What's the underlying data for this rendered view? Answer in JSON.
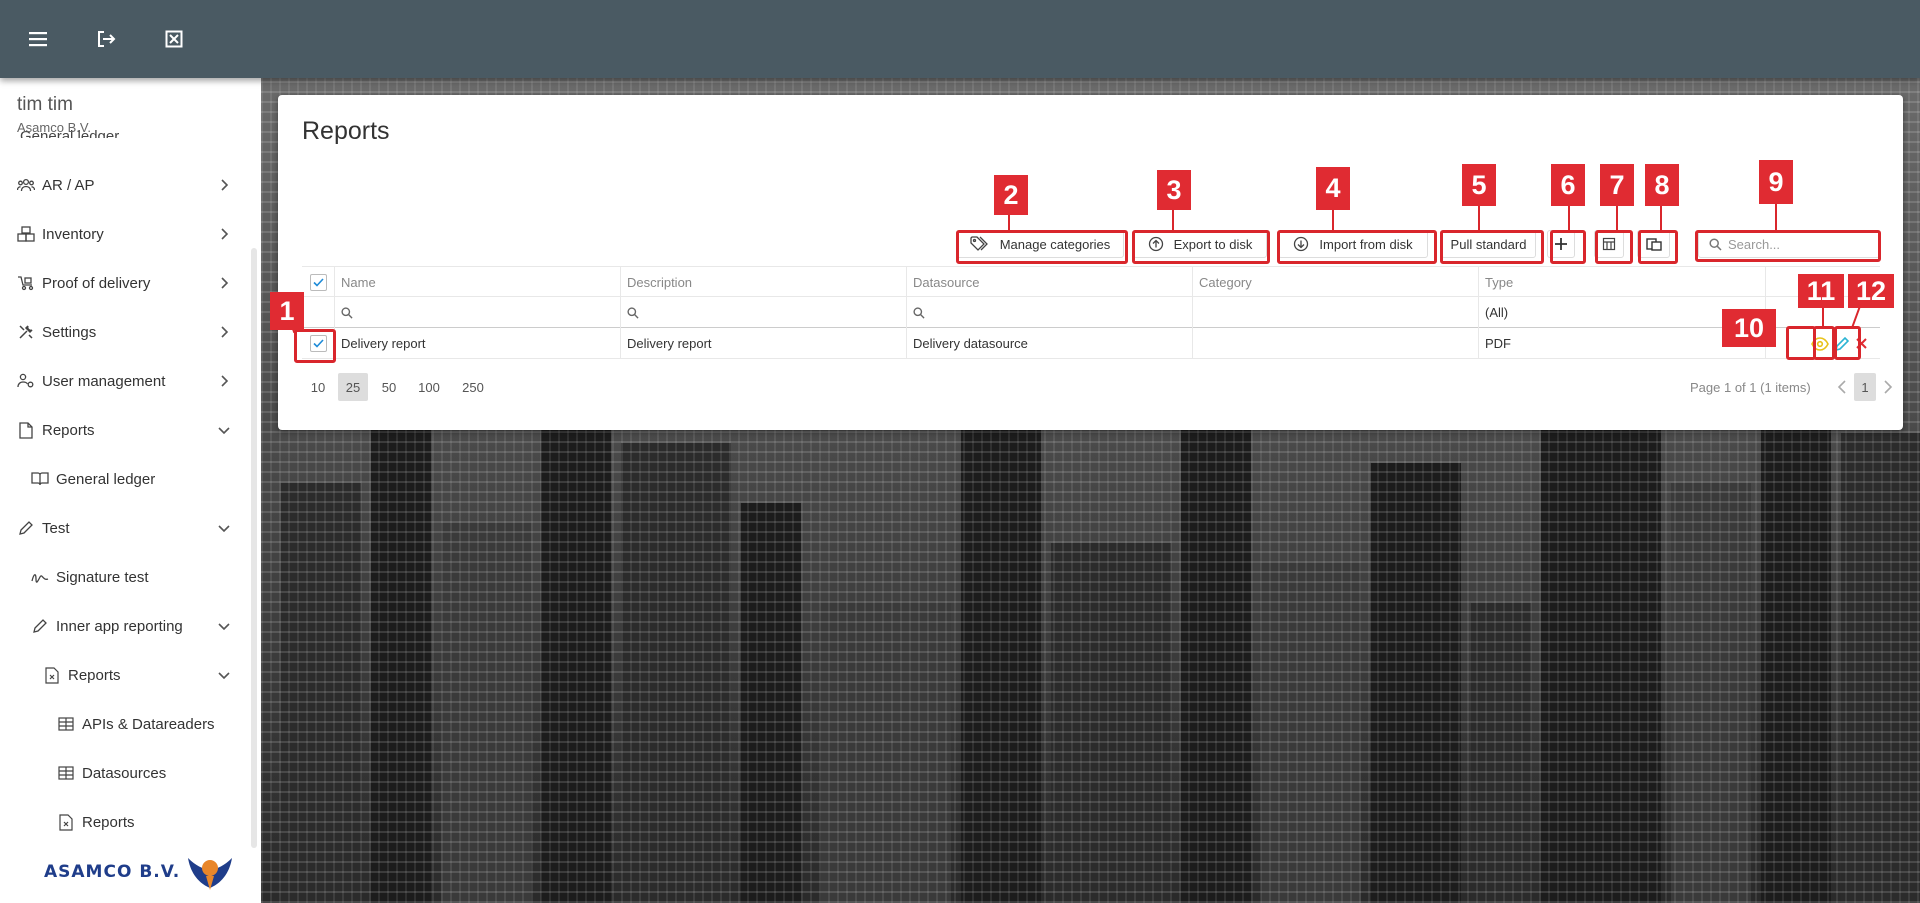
{
  "topbar": {
    "icons": [
      "menu-icon",
      "logout-icon",
      "close-window-icon"
    ]
  },
  "sidebar": {
    "user_name": "tim tim",
    "company": "Asamco B.V.",
    "cut_item": "General ledger",
    "items": [
      {
        "label": "AR / AP",
        "icon": "users-icon",
        "chevron": "right"
      },
      {
        "label": "Inventory",
        "icon": "boxes-icon",
        "chevron": "right"
      },
      {
        "label": "Proof of delivery",
        "icon": "delivery-icon",
        "chevron": "right"
      },
      {
        "label": "Settings",
        "icon": "tools-icon",
        "chevron": "right"
      },
      {
        "label": "User management",
        "icon": "user-gear-icon",
        "chevron": "right"
      },
      {
        "label": "Reports",
        "icon": "document-icon",
        "chevron": "down"
      },
      {
        "label": "General ledger",
        "icon": "book-icon",
        "chevron": ""
      },
      {
        "label": "Test",
        "icon": "pencil-icon",
        "chevron": "down"
      },
      {
        "label": "Signature test",
        "icon": "signature-icon",
        "chevron": ""
      },
      {
        "label": "Inner app reporting",
        "icon": "pencil-icon",
        "chevron": "down"
      },
      {
        "label": "Reports",
        "icon": "file-x-icon",
        "chevron": "down"
      },
      {
        "label": "APIs & Datareaders",
        "icon": "table-icon",
        "chevron": ""
      },
      {
        "label": "Datasources",
        "icon": "table-icon",
        "chevron": ""
      },
      {
        "label": "Reports",
        "icon": "file-x-icon",
        "chevron": ""
      }
    ],
    "logo_text": "ASAMCO B.V."
  },
  "page": {
    "title": "Reports"
  },
  "toolbar": {
    "manage_categories": "Manage categories",
    "export_to_disk": "Export to disk",
    "import_from_disk": "Import from disk",
    "pull_standard": "Pull standard",
    "search_placeholder": "Search..."
  },
  "grid": {
    "columns": [
      "Name",
      "Description",
      "Datasource",
      "Category",
      "Type"
    ],
    "type_filter": "(All)",
    "rows": [
      {
        "name": "Delivery report",
        "description": "Delivery report",
        "datasource": "Delivery datasource",
        "category": "",
        "type": "PDF"
      }
    ]
  },
  "pager": {
    "sizes": [
      "10",
      "25",
      "50",
      "100",
      "250"
    ],
    "active_size": "25",
    "info": "Page 1 of 1 (1 items)",
    "current_page": "1"
  },
  "annotations": [
    "1",
    "2",
    "3",
    "4",
    "5",
    "6",
    "7",
    "8",
    "9",
    "10",
    "11",
    "12"
  ],
  "colors": {
    "topbar": "#4a5a63",
    "marker": "#e02b32",
    "view_icon": "#e8c21a",
    "edit_icon": "#2bb4d4",
    "delete_icon": "#e02b32"
  }
}
